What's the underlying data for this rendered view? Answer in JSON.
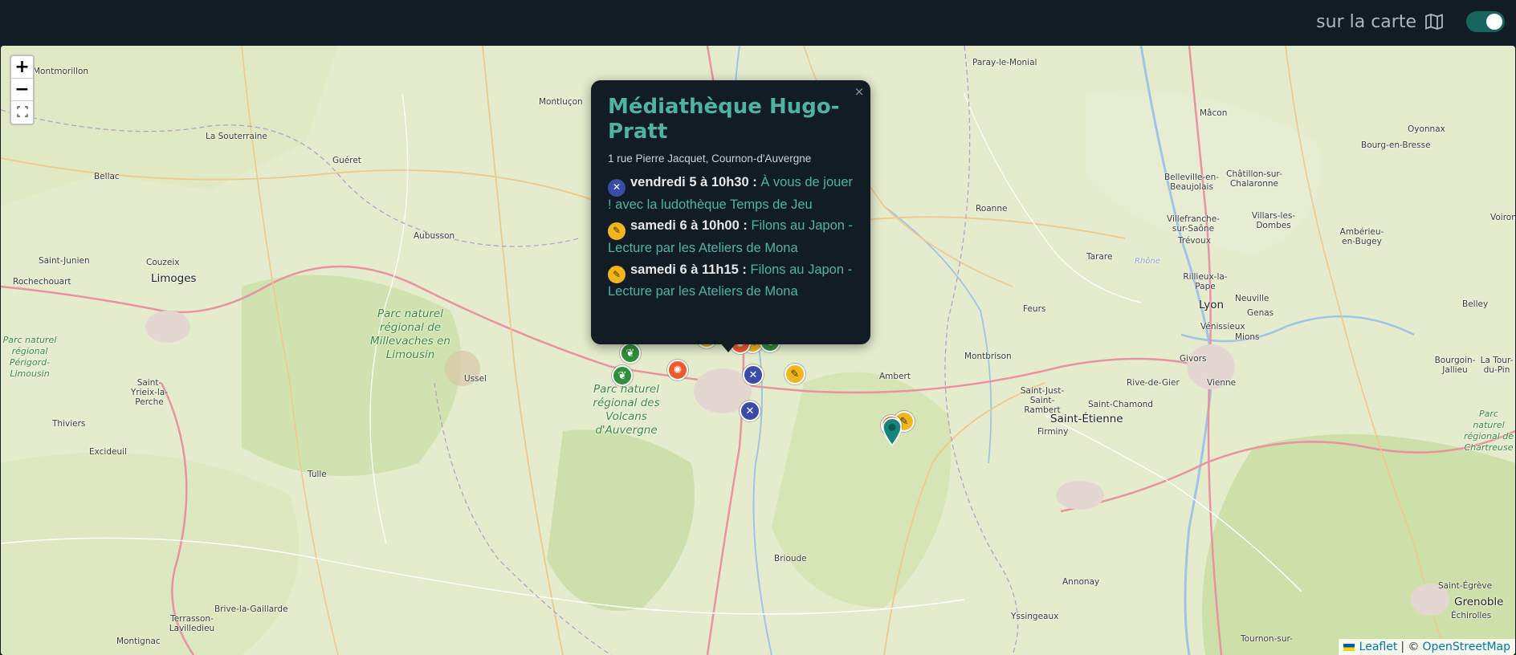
{
  "header": {
    "view_label": "sur la carte",
    "map_icon": "map-icon",
    "toggle_on": true
  },
  "map": {
    "zoom_in_label": "+",
    "zoom_out_label": "−",
    "fullscreen_icon": "fullscreen-icon",
    "places": [
      "Montmorillon",
      "Montluçon",
      "Paray-le-Monial",
      "La Souterraine",
      "Guéret",
      "Mâcon",
      "Oyonnax",
      "Bellac",
      "Bourg-en-Bresse",
      "Belleville-en-Beaujolais",
      "Châtillon-sur-Chalaronne",
      "Roanne",
      "Villefranche-sur-Saône",
      "Villars-les-Dombes",
      "Ambérieu-en-Bugey",
      "Aubusson",
      "Trévoux",
      "Saint-Junien",
      "Couzeix",
      "Tarare",
      "Rochechouart",
      "Limoges",
      "Rhône",
      "Rillieux-la-Pape",
      "Lyon",
      "Neuville",
      "Genas",
      "Vénissieux",
      "Mions",
      "Belley",
      "Feurs",
      "Ambert",
      "Montbrison",
      "Ussel",
      "Givors",
      "Saint-Yrieix-la-Perche",
      "Rive-de-Gier",
      "Vienne",
      "Bourgoin-Jallieu",
      "La Tour-du-Pin",
      "Saint-Just-Saint-Rambert",
      "Saint-Chamond",
      "Saint-Étienne",
      "Thiviers",
      "Firminy",
      "Excideuil",
      "Tulle",
      "Brioude",
      "Annonay",
      "Saint-Égrève",
      "Grenoble",
      "Échirolles",
      "Terrasson-Lavilledieu",
      "Brive-la-Gaillarde",
      "Yssingeaux",
      "Tournon-sur-",
      "Montignac",
      "Voiron"
    ],
    "parks": [
      "Parc naturel régional de Millevaches en Limousin",
      "Parc naturel régional des Volcans d'Auvergne",
      "Parc naturel régional Périgord-Limousin",
      "Parc naturel régional de Chartreuse"
    ]
  },
  "popup": {
    "title": "Médiathèque Hugo-Pratt",
    "address": "1 rue Pierre Jacquet, Cournon-d'Auvergne",
    "close_label": "×",
    "events": [
      {
        "icon": "tools-icon",
        "color": "#3a4ca8",
        "when": "vendredi 5 à 10h30 :",
        "title": "À vous de jouer ! avec la ludothèque Temps de Jeu"
      },
      {
        "icon": "reading-icon",
        "color": "#f2b51d",
        "when": "samedi 6 à 10h00 :",
        "title": "Filons au Japon - Lecture par les Ateliers de Mona"
      },
      {
        "icon": "reading-icon",
        "color": "#f2b51d",
        "when": "samedi 6 à 11h15 :",
        "title": "Filons au Japon - Lecture par les Ateliers de Mona"
      }
    ]
  },
  "attribution": {
    "leaflet": "Leaflet",
    "separator": "| ©",
    "osm": "OpenStreetMap"
  },
  "colors": {
    "accent": "#4fb3a4",
    "header_bg": "#121c24",
    "toggle": "#17655f"
  }
}
